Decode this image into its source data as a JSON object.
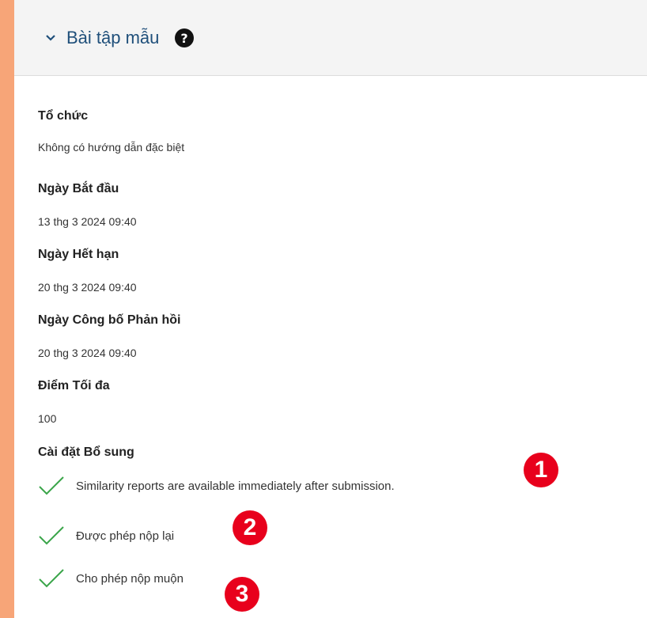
{
  "header": {
    "title": "Bài tập mẫu"
  },
  "fields": [
    {
      "label": "Tổ chức",
      "value": "Không có hướng dẫn đặc biệt"
    },
    {
      "label": "Ngày Bắt đầu",
      "value": "13 thg 3 2024 09:40"
    },
    {
      "label": "Ngày Hết hạn",
      "value": "20 thg 3 2024 09:40"
    },
    {
      "label": "Ngày Công bố Phản hồi",
      "value": "20 thg 3 2024 09:40"
    },
    {
      "label": "Điểm Tối đa",
      "value": "100"
    }
  ],
  "additional": {
    "label": "Cài đặt Bổ sung",
    "items": [
      "Similarity reports are available immediately after submission.",
      "Được phép nộp lại",
      "Cho phép nộp muộn"
    ]
  },
  "badges": [
    "1",
    "2",
    "3"
  ],
  "colors": {
    "accent": "#1f4f7a",
    "check": "#3aa54a",
    "badge": "#e8001c",
    "frame": "#f7a578"
  }
}
